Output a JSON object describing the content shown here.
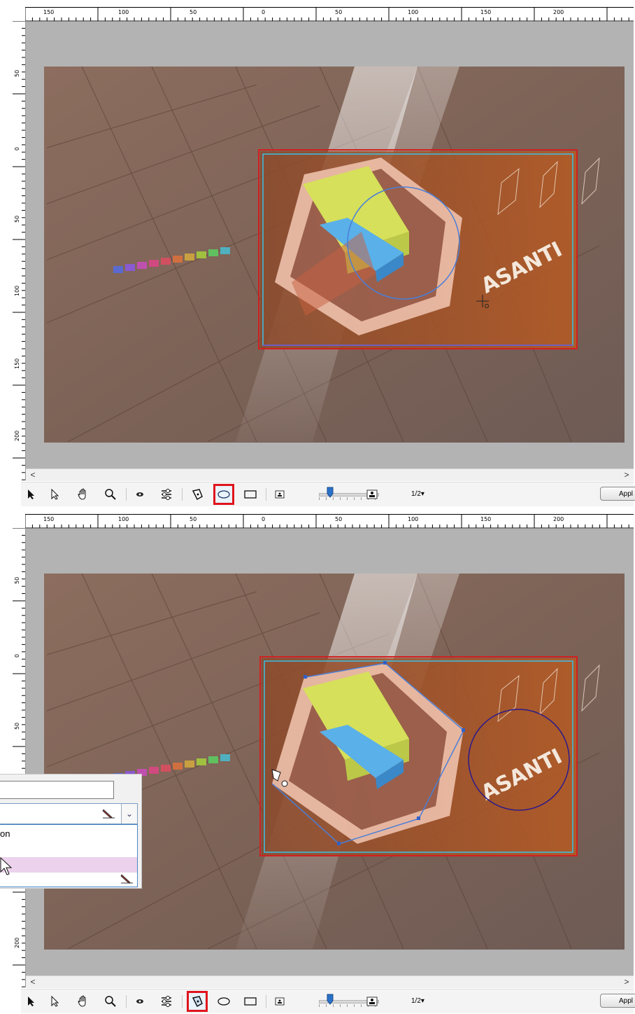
{
  "ruler": {
    "h_labels": [
      "150",
      "100",
      "50",
      "0",
      "50",
      "100",
      "150",
      "200"
    ],
    "v_labels": [
      "50",
      "0",
      "50",
      "100",
      "150",
      "200"
    ]
  },
  "artwork": {
    "brand_text": "ASANTI"
  },
  "toolbar": {
    "tools": [
      "selection-tool",
      "direct-selection-tool",
      "hand-tool",
      "zoom-tool",
      "preview-eye",
      "adjust-settings",
      "pen-tool",
      "ellipse-tool",
      "rectangle-tool"
    ],
    "zoom_label": "1/2▾",
    "apply_label": "Appl"
  },
  "scrollbar": {
    "left_arrow": "<",
    "right_arrow": ">"
  },
  "top_panel": {
    "highlighted_tool": "ellipse-tool"
  },
  "bottom_panel": {
    "highlighted_tool": "pen-tool",
    "dropdown": {
      "text_field_value": "",
      "list_items": [
        "on",
        "",
        ""
      ]
    }
  },
  "colors": {
    "highlight": "#e0141e",
    "ellipse_top": "#4a7fd8",
    "ellipse_bottom": "#2a1a8a",
    "guide": "#3ac0e8",
    "frame": "#d02020",
    "list_selected": "#ecd2ec"
  }
}
